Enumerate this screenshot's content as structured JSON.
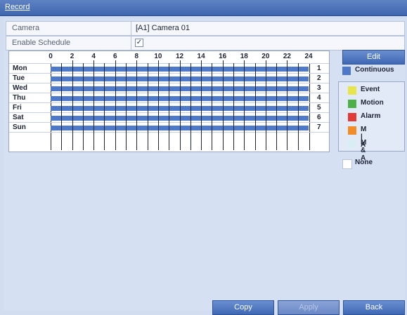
{
  "window": {
    "title": "Record"
  },
  "camera": {
    "label": "Camera",
    "value": "[A1] Camera 01"
  },
  "schedule": {
    "label": "Enable Schedule",
    "checked": true,
    "check_glyph": "✓"
  },
  "grid": {
    "hours": [
      "0",
      "2",
      "4",
      "6",
      "8",
      "10",
      "12",
      "14",
      "16",
      "18",
      "20",
      "22",
      "24"
    ],
    "days": [
      {
        "name": "Mon",
        "num": "1"
      },
      {
        "name": "Tue",
        "num": "2"
      },
      {
        "name": "Wed",
        "num": "3"
      },
      {
        "name": "Thu",
        "num": "4"
      },
      {
        "name": "Fri",
        "num": "5"
      },
      {
        "name": "Sat",
        "num": "6"
      },
      {
        "name": "Sun",
        "num": "7"
      }
    ],
    "bar_color": "#4e78c8"
  },
  "buttons": {
    "edit": "Edit",
    "copy": "Copy",
    "apply": "Apply",
    "back": "Back"
  },
  "legend": {
    "continuous": {
      "label": "Continuous",
      "color": "#4e78c8"
    },
    "items": [
      {
        "label": "Event",
        "color": "#e6e64a"
      },
      {
        "label": "Motion",
        "color": "#4fb04a"
      },
      {
        "label": "Alarm",
        "color": "#e23a36"
      },
      {
        "label": "M | A",
        "color": "#f28c28"
      },
      {
        "label": "M & A",
        "color": "#d9eef4"
      }
    ],
    "none": {
      "label": "None",
      "color": "#ffffff"
    }
  }
}
